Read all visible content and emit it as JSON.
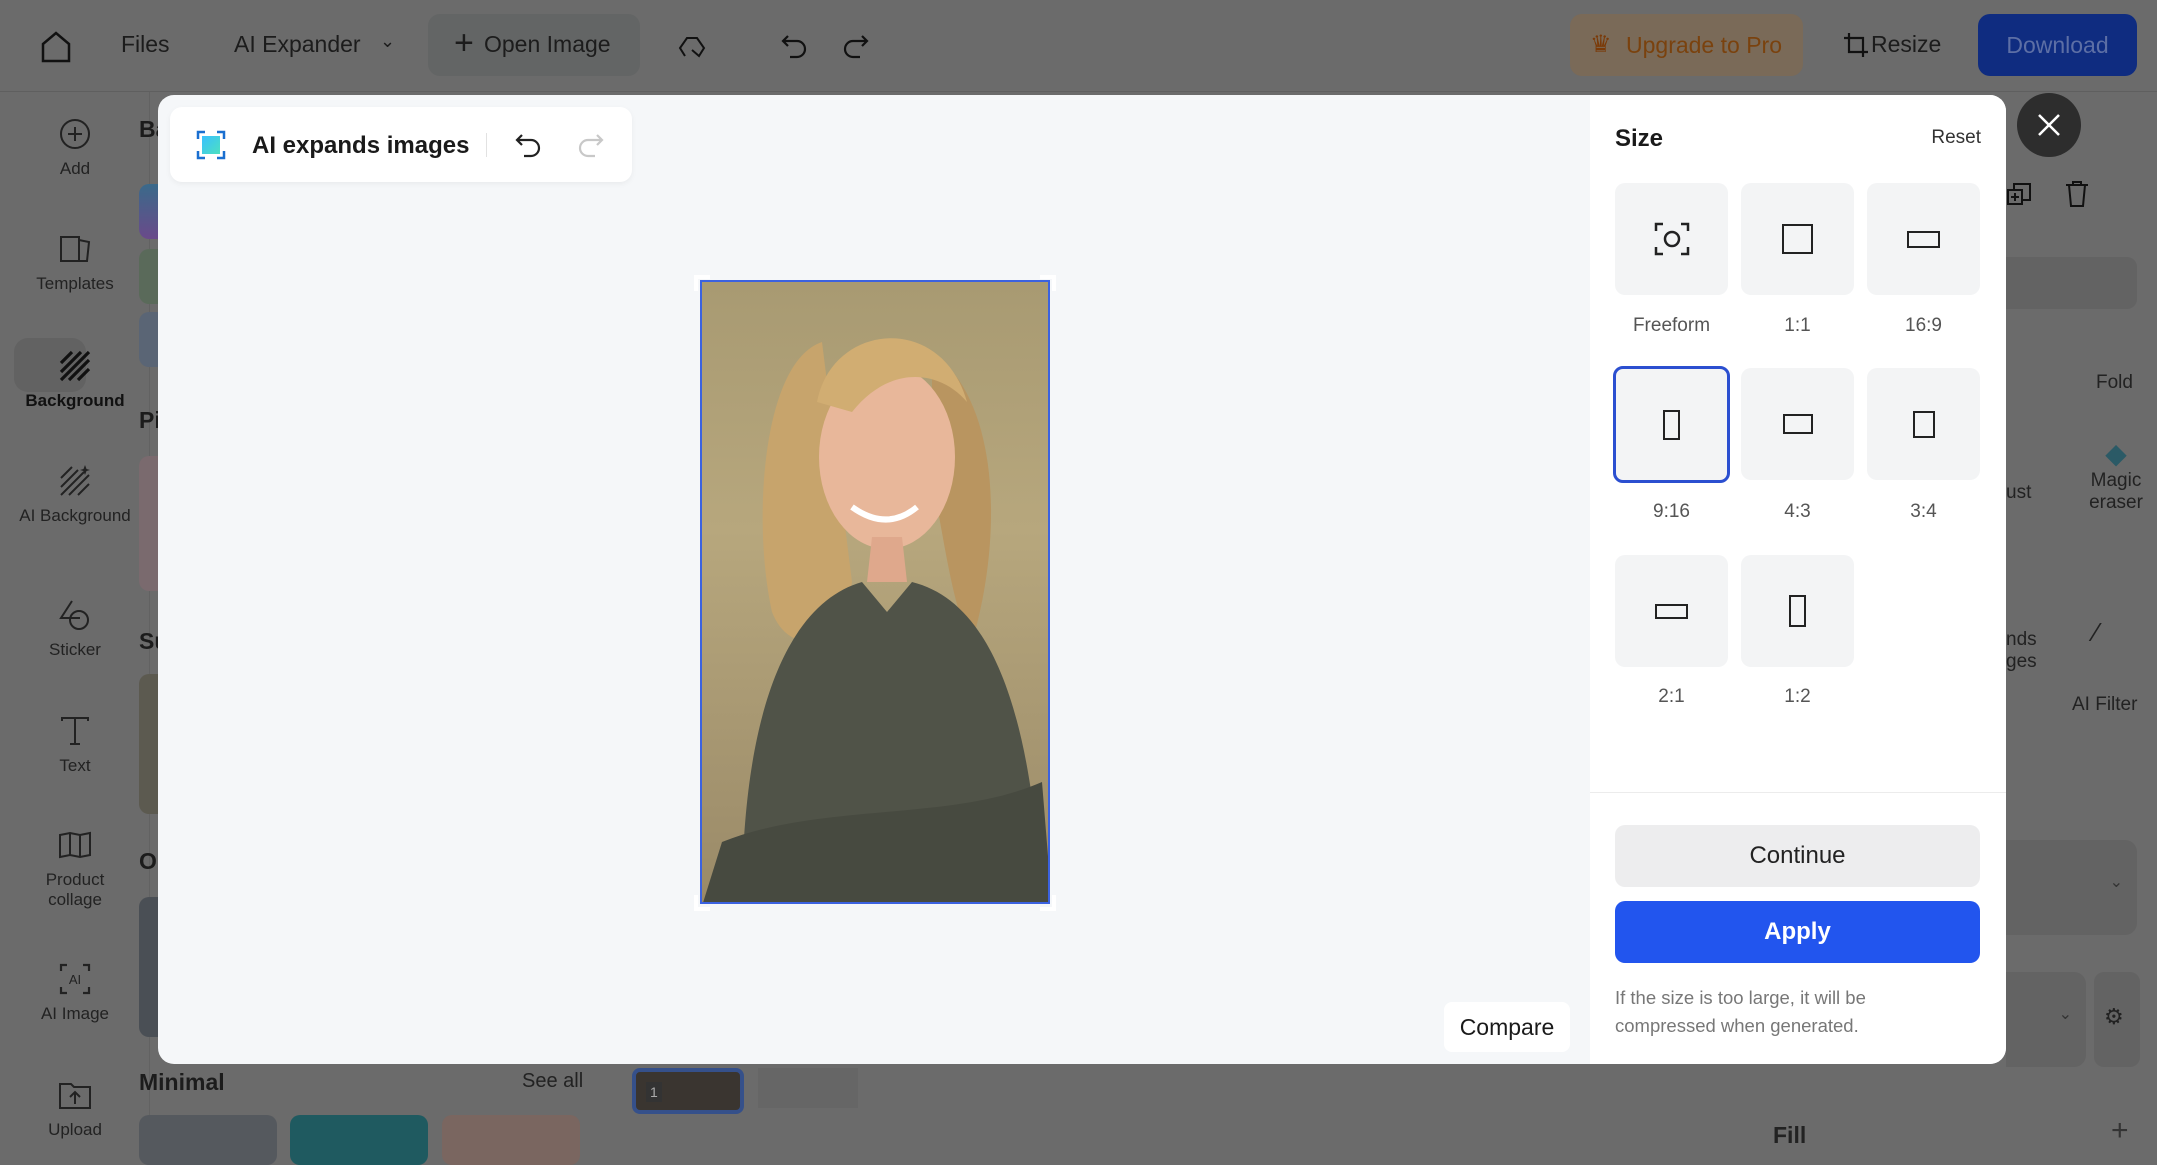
{
  "topbar": {
    "files": "Files",
    "ai_expander": "AI Expander",
    "open_image": "Open Image",
    "upgrade": "Upgrade to Pro",
    "resize": "Resize",
    "download": "Download"
  },
  "sidebar": {
    "items": [
      {
        "label": "Add",
        "icon": "plus-circle-icon"
      },
      {
        "label": "Templates",
        "icon": "templates-icon"
      },
      {
        "label": "Background",
        "icon": "background-icon"
      },
      {
        "label": "AI Background",
        "icon": "ai-background-icon"
      },
      {
        "label": "Sticker",
        "icon": "sticker-icon"
      },
      {
        "label": "Text",
        "icon": "text-icon"
      },
      {
        "label": "Product collage",
        "icon": "collage-icon"
      },
      {
        "label": "AI Image",
        "icon": "ai-image-icon"
      },
      {
        "label": "Upload",
        "icon": "upload-icon"
      }
    ]
  },
  "panel2": {
    "sections": [
      "Ba",
      "Pi",
      "Su",
      "O"
    ],
    "minimal": "Minimal",
    "see_all": "See all"
  },
  "rightpanel": {
    "fold": "Fold",
    "adjust": "ust",
    "magic_eraser": "Magic eraser",
    "ai_expands": "nds ges",
    "ai_filter": "AI Filter",
    "fill": "Fill",
    "page_number": "1"
  },
  "modal": {
    "title": "AI expands images",
    "compare": "Compare",
    "size": {
      "title": "Size",
      "reset": "Reset",
      "selected": "9:16",
      "options": [
        {
          "label": "Freeform"
        },
        {
          "label": "1:1"
        },
        {
          "label": "16:9"
        },
        {
          "label": "9:16"
        },
        {
          "label": "4:3"
        },
        {
          "label": "3:4"
        },
        {
          "label": "2:1"
        },
        {
          "label": "1:2"
        }
      ]
    },
    "continue": "Continue",
    "apply": "Apply",
    "note": "If the size is too large, it will be compressed when generated."
  },
  "colors": {
    "accent": "#2255ee",
    "selected_border": "#2b4fd0",
    "download": "#0f2c80",
    "upgrade_text": "#8a4a10"
  }
}
